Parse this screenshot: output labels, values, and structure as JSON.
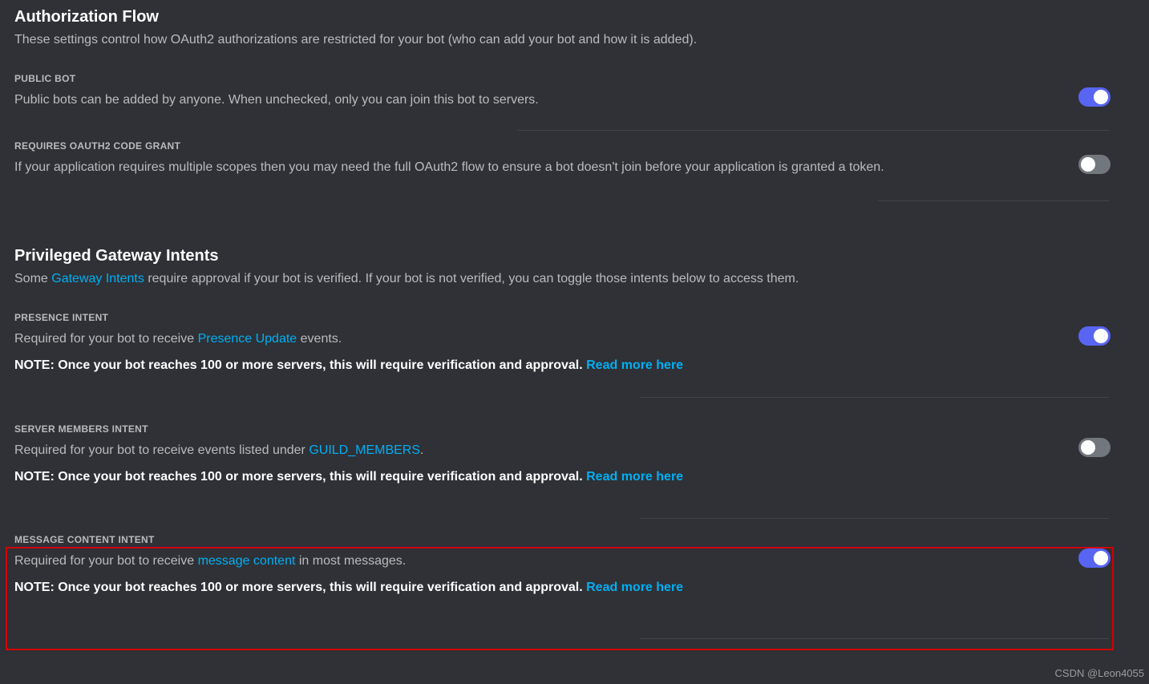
{
  "authFlow": {
    "title": "Authorization Flow",
    "desc": "These settings control how OAuth2 authorizations are restricted for your bot (who can add your bot and how it is added).",
    "publicBot": {
      "label": "PUBLIC BOT",
      "desc": "Public bots can be added by anyone. When unchecked, only you can join this bot to servers.",
      "toggle": true
    },
    "codeGrant": {
      "label": "REQUIRES OAUTH2 CODE GRANT",
      "desc": "If your application requires multiple scopes then you may need the full OAuth2 flow to ensure a bot doesn't join before your application is granted a token.",
      "toggle": false
    }
  },
  "intents": {
    "title": "Privileged Gateway Intents",
    "descPrefix": "Some ",
    "gatewayLink": "Gateway Intents",
    "descSuffix": " require approval if your bot is verified. If your bot is not verified, you can toggle those intents below to access them.",
    "noteText": "NOTE: Once your bot reaches 100 or more servers, this will require verification and approval. ",
    "readMore": "Read more here",
    "presence": {
      "label": "PRESENCE INTENT",
      "descPrefix": "Required for your bot to receive ",
      "link": "Presence Update",
      "descSuffix": " events.",
      "toggle": true
    },
    "members": {
      "label": "SERVER MEMBERS INTENT",
      "descPrefix": "Required for your bot to receive events listed under ",
      "link": "GUILD_MEMBERS",
      "descSuffix": ".",
      "toggle": false
    },
    "message": {
      "label": "MESSAGE CONTENT INTENT",
      "descPrefix": "Required for your bot to receive ",
      "link": "message content",
      "descSuffix": " in most messages.",
      "toggle": true
    }
  },
  "watermark": "CSDN @Leon4055"
}
